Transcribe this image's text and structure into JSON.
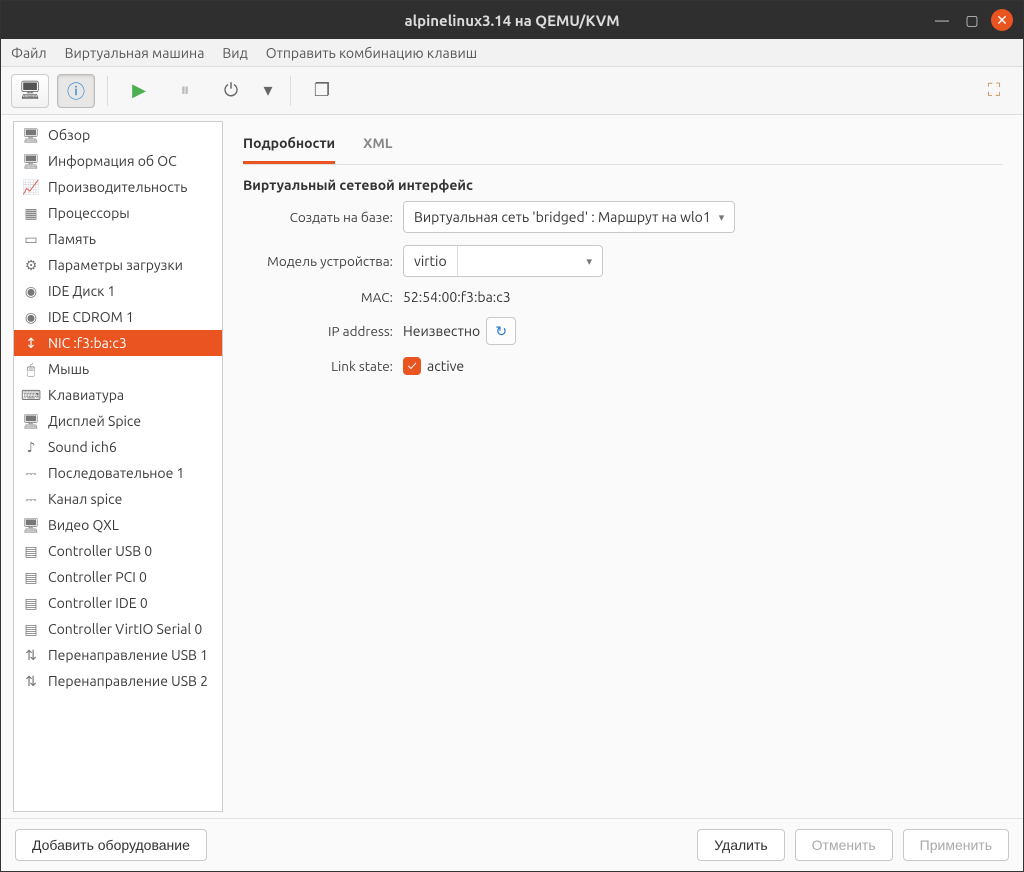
{
  "window_title": "alpinelinux3.14 на QEMU/KVM",
  "menubar": [
    "Файл",
    "Виртуальная машина",
    "Вид",
    "Отправить комбинацию клавиш"
  ],
  "sidebar": [
    {
      "label": "Обзор",
      "icon": "🖥"
    },
    {
      "label": "Информация об ОС",
      "icon": "🖥"
    },
    {
      "label": "Производительность",
      "icon": "📈"
    },
    {
      "label": "Процессоры",
      "icon": "▦"
    },
    {
      "label": "Память",
      "icon": "▭"
    },
    {
      "label": "Параметры загрузки",
      "icon": "⚙"
    },
    {
      "label": "IDE Диск 1",
      "icon": "◉"
    },
    {
      "label": "IDE CDROM 1",
      "icon": "◉"
    },
    {
      "label": "NIC :f3:ba:c3",
      "icon": "↕",
      "selected": true
    },
    {
      "label": "Мышь",
      "icon": "🖱"
    },
    {
      "label": "Клавиатура",
      "icon": "⌨"
    },
    {
      "label": "Дисплей Spice",
      "icon": "🖥"
    },
    {
      "label": "Sound ich6",
      "icon": "♪"
    },
    {
      "label": "Последовательное 1",
      "icon": "⎓"
    },
    {
      "label": "Канал spice",
      "icon": "⎓"
    },
    {
      "label": "Видео QXL",
      "icon": "🖥"
    },
    {
      "label": "Controller USB 0",
      "icon": "▤"
    },
    {
      "label": "Controller PCI 0",
      "icon": "▤"
    },
    {
      "label": "Controller IDE 0",
      "icon": "▤"
    },
    {
      "label": "Controller VirtIO Serial 0",
      "icon": "▤"
    },
    {
      "label": "Перенаправление USB 1",
      "icon": "⇅"
    },
    {
      "label": "Перенаправление USB 2",
      "icon": "⇅"
    }
  ],
  "tabs": {
    "details": "Подробности",
    "xml": "XML"
  },
  "panel": {
    "heading": "Виртуальный сетевой интерфейс",
    "source_label": "Создать на базе:",
    "source_value": "Виртуальная сеть 'bridged' : Маршрут на wlo1",
    "model_label": "Модель устройства:",
    "model_value": "virtio",
    "mac_label": "MAC:",
    "mac_value": "52:54:00:f3:ba:c3",
    "ip_label": "IP address:",
    "ip_value": "Неизвестно",
    "link_label": "Link state:",
    "link_value": "active"
  },
  "buttons": {
    "add_hw": "Добавить оборудование",
    "delete": "Удалить",
    "cancel": "Отменить",
    "apply": "Применить"
  }
}
